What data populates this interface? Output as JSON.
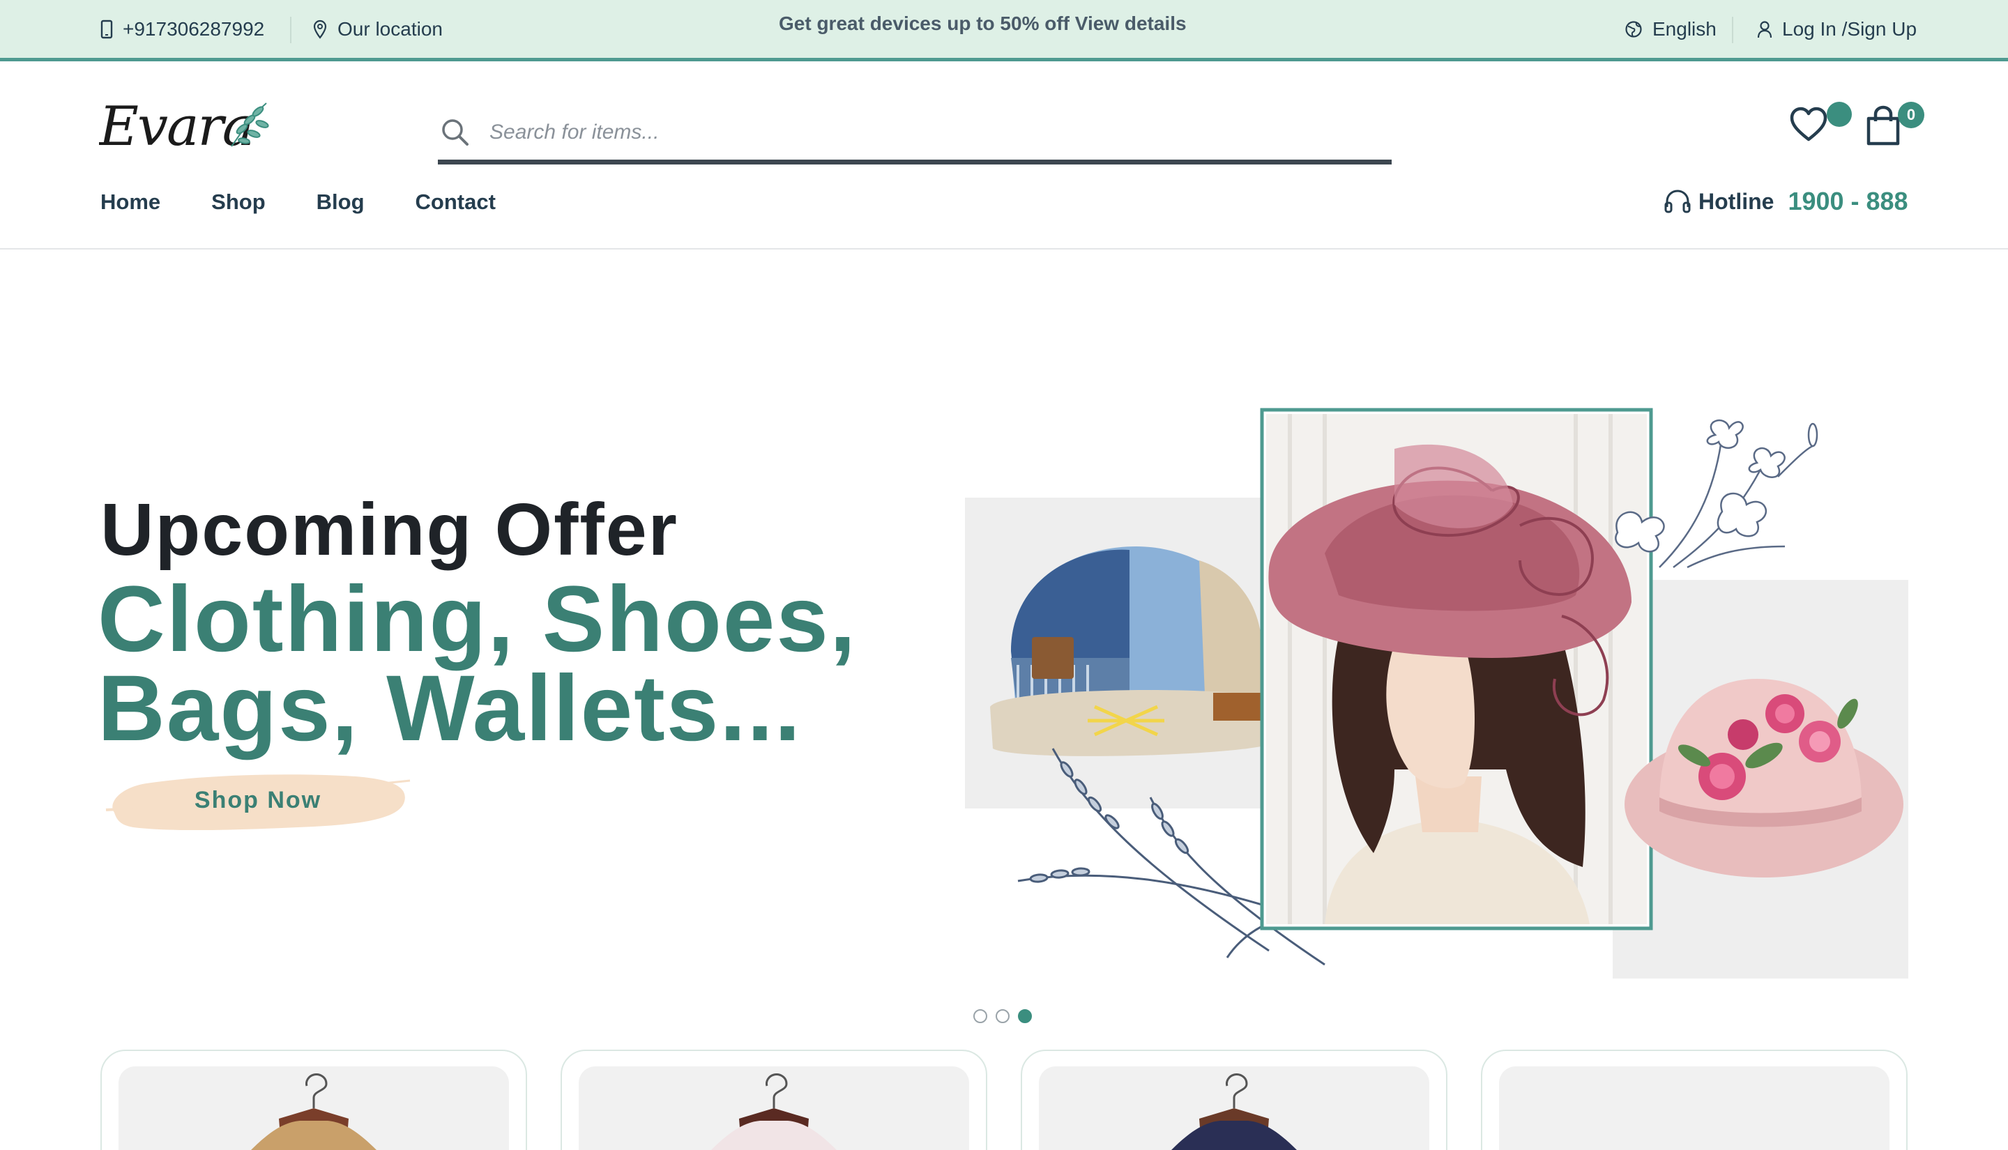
{
  "topbar": {
    "phone": "+917306287992",
    "location": "Our location",
    "promo": "Get great devices up to 50% off View details",
    "language": "English",
    "login": "Log In /Sign Up"
  },
  "header": {
    "logo_text": "Evara",
    "search_placeholder": "Search for items...",
    "wishlist_icon": "heart-icon",
    "cart_icon": "shopping-bag-icon",
    "cart_count": "0"
  },
  "nav": {
    "items": [
      "Home",
      "Shop",
      "Blog",
      "Contact"
    ],
    "hotline_label": "Hotline",
    "hotline_number": "1900 - 888"
  },
  "hero": {
    "pre_title": "Upcoming Offer",
    "title_line1": "Clothing, Shoes,",
    "title_line2": "Bags, Wallets...",
    "cta": "Shop Now",
    "slides": 3,
    "active_slide": 3
  },
  "colors": {
    "brand": "#3b8e7f",
    "topbar_bg": "#def0e6",
    "text": "#253d4e",
    "cta_bg": "#f6dfc8"
  },
  "products": {
    "count_visible": 4
  }
}
